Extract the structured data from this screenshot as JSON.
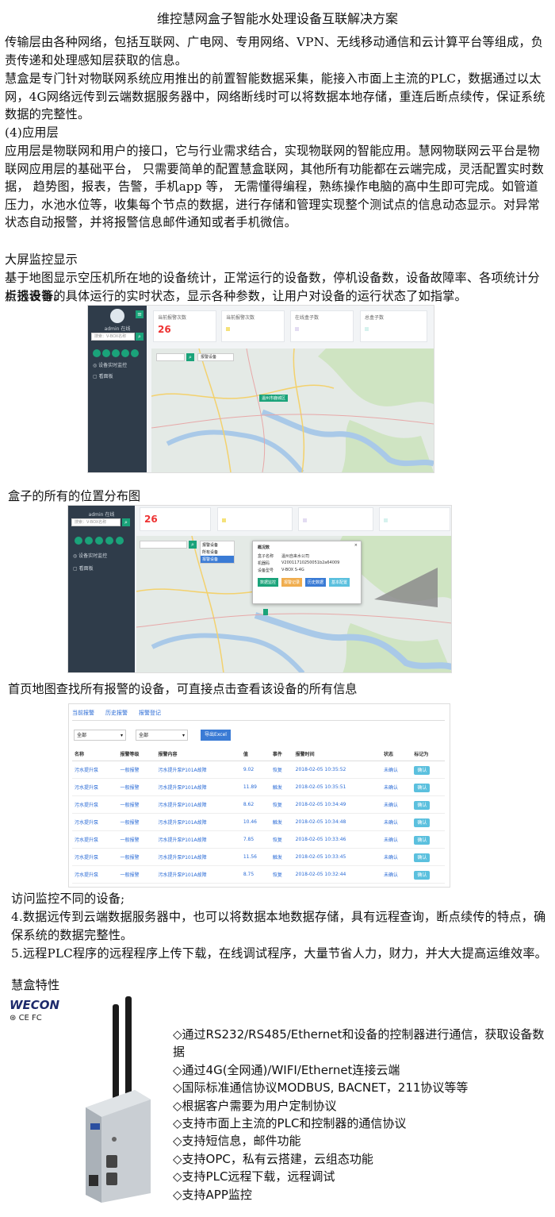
{
  "title": "维控慧网盒子智能水处理设备互联解决方案",
  "paragraphs": [
    "传输层由各种网络，包括互联网、广电网、专用网络、VPN、无线移动通信和云计算平台等组成，负责传递和处理感知层获取的信息。",
    "慧盒是专门针对物联网系统应用推出的前置智能数据采集，能接入市面上主流的PLC，数据通过以太网，4G网络远传到云端数据服务器中，网络断线时可以将数据本地存储，重连后断点续传，保证系统数据的完整性。",
    "(4)应用层",
    "应用层是物联网和用户的接口，它与行业需求结合，实现物联网的智能应用。慧网物联网云平台是物联网应用层的基础平台， 只需要简单的配置慧盒联网，其他所有功能都在云端完成，灵活配置实时数据， 趋势图，报表，告警，手机app 等， 无需懂得编程，熟练操作电脑的高中生即可完成。如管道压力，水池水位等，收集每个节点的数据，进行存储和管理实现整个测试点的信息动态显示。对异常状态自动报警，并将报警信息邮件通知或者手机微信。",
    "大屏监控显示",
    "基于地图显示空压机所在地的设备统计，正常运行的设备数，停机设备数，设备故障率、各项统计分析报表等。",
    "点选设备的具体运行的实时状态，显示各种参数，让用户对设备的运行状态了如指掌。"
  ],
  "screen1": {
    "user": "admin 在线",
    "search_placeholder": "搜索：V-BOX名称",
    "menu": [
      "设备实时监控",
      "看面板"
    ],
    "cards": [
      {
        "label": "当前报警次数",
        "value": "26"
      },
      {
        "label": "当前报警次数",
        "value": ""
      },
      {
        "label": "在线盒子数",
        "value": ""
      },
      {
        "label": "总盒子数",
        "value": ""
      }
    ],
    "map_search": "报警设备",
    "marker": "温州市鹿城区"
  },
  "caption1": "盒子的所有的位置分布图",
  "screen2": {
    "user": "admin 在线",
    "search_placeholder": "搜索：V-BOX名称",
    "menu": [
      "设备实时监控",
      "看面板"
    ],
    "card_value": "26",
    "dropdown": [
      "报警设备",
      "所有设备",
      "报警设备"
    ],
    "popup_title": "概况数",
    "popup_rows": [
      {
        "k": "盒子名称",
        "v": "温州自来水公司"
      },
      {
        "k": "机器码",
        "v": "V20011710250051b2a64009"
      },
      {
        "k": "设备型号",
        "v": "V-BOX S-4G"
      }
    ],
    "popup_buttons": [
      "数据监控",
      "报警记录",
      "历史数据",
      "基本配置"
    ]
  },
  "caption2": "首页地图查找所有报警的设备，可直接点击查看该设备的所有信息",
  "alarm": {
    "tabs": [
      "当前报警",
      "历史报警",
      "报警登记"
    ],
    "filters": [
      "全部",
      "全部"
    ],
    "export": "导出Excel",
    "headers": [
      "名称",
      "报警等级",
      "报警内容",
      "值",
      "事件",
      "报警时间",
      "状态",
      "标记为"
    ],
    "rows": [
      [
        "污水提升泵",
        "一般报警",
        "污水提升泵P101A故障",
        "9.02",
        "恢复",
        "2018-02-05 10:35:52",
        "未确认",
        "确认"
      ],
      [
        "污水提升泵",
        "一般报警",
        "污水提升泵P101A故障",
        "11.89",
        "触发",
        "2018-02-05 10:35:51",
        "未确认",
        "确认"
      ],
      [
        "污水提升泵",
        "一般报警",
        "污水提升泵P101A故障",
        "8.62",
        "恢复",
        "2018-02-05 10:34:49",
        "未确认",
        "确认"
      ],
      [
        "污水提升泵",
        "一般报警",
        "污水提升泵P101A故障",
        "10.46",
        "触发",
        "2018-02-05 10:34:48",
        "未确认",
        "确认"
      ],
      [
        "污水提升泵",
        "一般报警",
        "污水提升泵P101A故障",
        "7.85",
        "恢复",
        "2018-02-05 10:33:46",
        "未确认",
        "确认"
      ],
      [
        "污水提升泵",
        "一般报警",
        "污水提升泵P101A故障",
        "11.56",
        "触发",
        "2018-02-05 10:33:45",
        "未确认",
        "确认"
      ],
      [
        "污水提升泵",
        "一般报警",
        "污水提升泵P101A故障",
        "8.75",
        "恢复",
        "2018-02-05 10:32:44",
        "未确认",
        "确认"
      ]
    ]
  },
  "paragraphs2": [
    "访问监控不同的设备;",
    "4.数据远传到云端数据服务器中，也可以将数据本地数据存储，具有远程查询，断点续传的特点，确保系统的数据完整性。",
    "5.远程PLC程序的远程程序上传下载，在线调试程序，大量节省人力，财力，并大大提高运维效率。",
    "慧盒特性"
  ],
  "brand": {
    "logo": "WECON",
    "certs": "CE FC"
  },
  "features": [
    "◇通过RS232/RS485/Ethernet和设备的控制器进行通信，获取设备数据",
    "◇通过4G(全网通)/WIFI/Ethernet连接云端",
    "◇国际标准通信协议MODBUS, BACNET，211协议等等",
    "◇根据客户需要为用户定制协议",
    "◇支持市面上主流的PLC和控制器的通信协议",
    "◇支持短信息，邮件功能",
    "◇支持OPC，私有云搭建，云组态功能",
    "◇支持PLC远程下载，远程调试",
    "◇支持APP监控"
  ]
}
